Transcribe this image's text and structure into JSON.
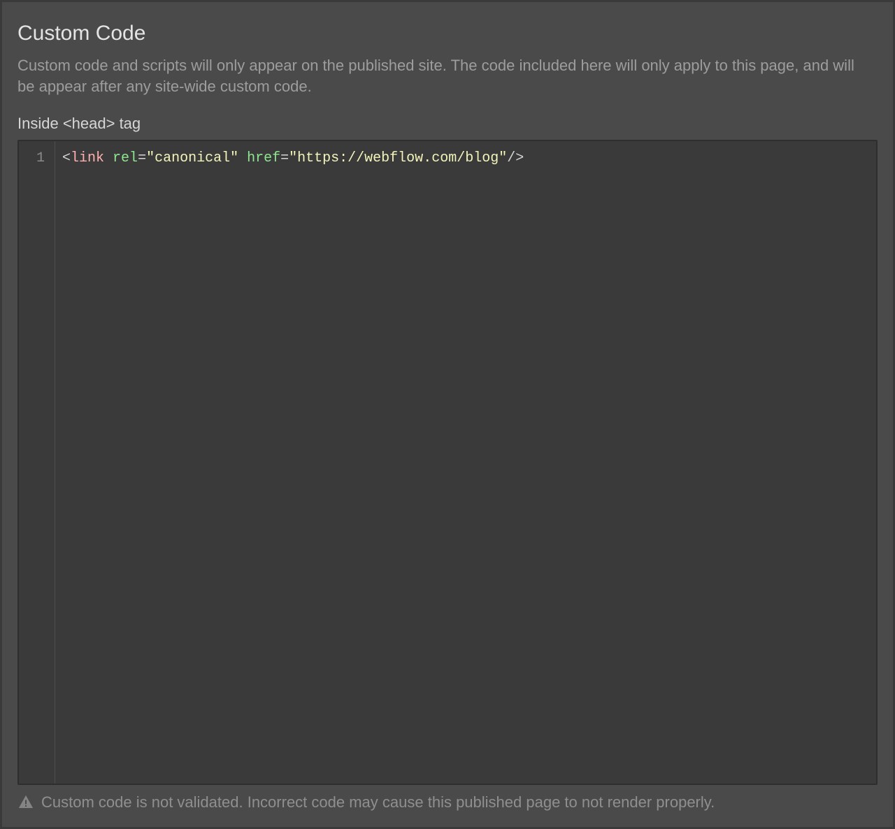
{
  "section": {
    "title": "Custom Code",
    "description": "Custom code and scripts will only appear on the published site. The code included here will only apply to this page, and will be appear after any site-wide custom code."
  },
  "head_editor": {
    "label": "Inside <head> tag",
    "line_numbers": [
      "1"
    ],
    "code_tokens": [
      {
        "t": "punct",
        "v": "<"
      },
      {
        "t": "tag",
        "v": "link"
      },
      {
        "t": "space",
        "v": " "
      },
      {
        "t": "attr",
        "v": "rel"
      },
      {
        "t": "eq",
        "v": "="
      },
      {
        "t": "str",
        "v": "\"canonical\""
      },
      {
        "t": "space",
        "v": " "
      },
      {
        "t": "attr",
        "v": "href"
      },
      {
        "t": "eq",
        "v": "="
      },
      {
        "t": "str",
        "v": "\"https://webflow.com/blog\""
      },
      {
        "t": "punct",
        "v": "/>"
      }
    ],
    "raw_code": "<link rel=\"canonical\" href=\"https://webflow.com/blog\"/>"
  },
  "footer": {
    "warning": "Custom code is not validated. Incorrect code may cause this published page to not render properly."
  }
}
